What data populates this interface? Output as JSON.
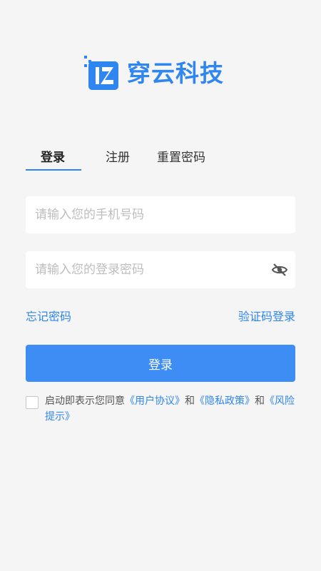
{
  "brand": {
    "name": "穿云科技",
    "color": "#2f86f0",
    "logo_icon": "brand-logo-icon"
  },
  "tabs": [
    {
      "label": "登录",
      "active": true
    },
    {
      "label": "注册",
      "active": false
    },
    {
      "label": "重置密码",
      "active": false
    }
  ],
  "form": {
    "phone_placeholder": "请输入您的手机号码",
    "phone_value": "",
    "password_placeholder": "请输入您的登录密码",
    "password_value": "",
    "password_toggle_icon": "eye-off-icon"
  },
  "links": {
    "forgot": "忘记密码",
    "sms_login": "验证码登录"
  },
  "login_button": "登录",
  "agreement": {
    "checked": false,
    "prefix": "启动即表示您同意",
    "user_agreement": "《用户协议》",
    "and1": "和",
    "privacy": "《隐私政策》",
    "and2": "和",
    "risk": "《风险提示》"
  },
  "colors": {
    "accent": "#2f86f0",
    "button": "#3d8df5",
    "background": "#f5f5f5"
  }
}
